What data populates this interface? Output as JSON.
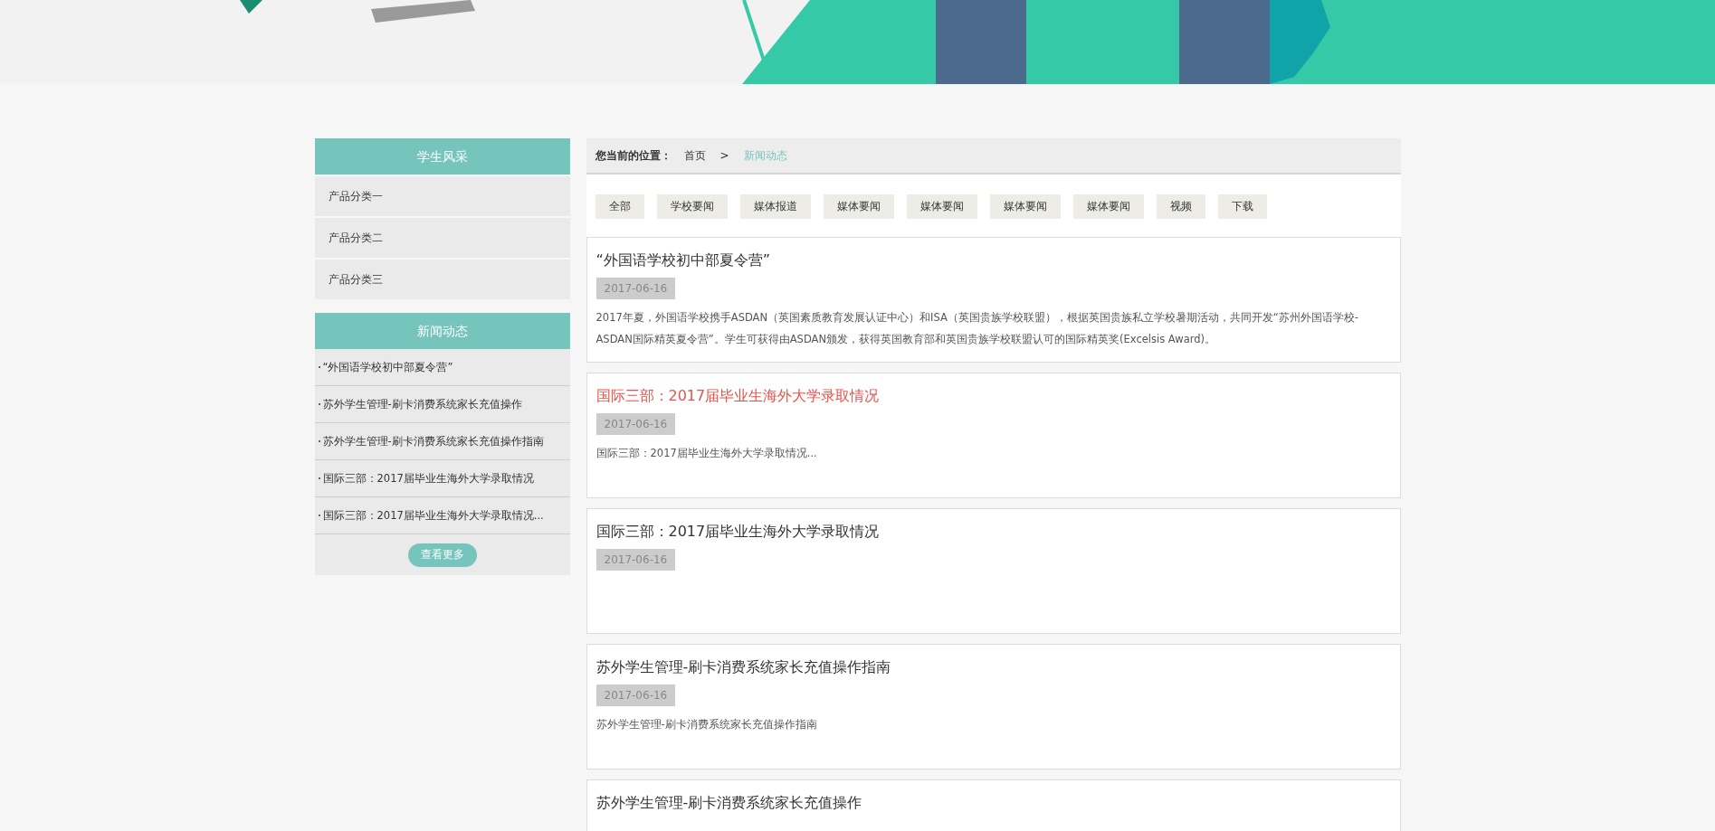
{
  "sidebar": {
    "categories": {
      "title": "学生风采",
      "items": [
        {
          "label": "产品分类一"
        },
        {
          "label": "产品分类二"
        },
        {
          "label": "产品分类三"
        }
      ]
    },
    "news": {
      "title": "新闻动态",
      "items": [
        {
          "label": "“外国语学校初中部夏令营”"
        },
        {
          "label": "苏外学生管理-刷卡消费系统家长充值操作"
        },
        {
          "label": "苏外学生管理-刷卡消费系统家长充值操作指南"
        },
        {
          "label": "国际三部：2017届毕业生海外大学录取情况"
        },
        {
          "label": "国际三部：2017届毕业生海外大学录取情况..."
        }
      ],
      "more_button": "查看更多"
    }
  },
  "breadcrumb": {
    "label": "您当前的位置：",
    "items": [
      {
        "text": "首页",
        "current": false
      },
      {
        "text": ">",
        "kind": "separator"
      },
      {
        "text": "新闻动态",
        "current": true
      }
    ]
  },
  "filter_tabs": [
    {
      "label": "全部"
    },
    {
      "label": "学校要闻"
    },
    {
      "label": "媒体报道"
    },
    {
      "label": "媒体要闻"
    },
    {
      "label": "媒体要闻"
    },
    {
      "label": "媒体要闻"
    },
    {
      "label": "媒体要闻"
    },
    {
      "label": "视频"
    },
    {
      "label": "下载"
    }
  ],
  "articles": [
    {
      "title": "“外国语学校初中部夏令营”",
      "highlighted": false,
      "date": "2017-06-16",
      "excerpt": "2017年夏，外国语学校携手ASDAN（英国素质教育发展认证中心）和ISA（英国贵族学校联盟），根据英国贵族私立学校暑期活动，共同开发“苏州外国语学校-ASDAN国际精英夏令营”。学生可获得由ASDAN颁发，获得英国教育部和英国贵族学校联盟认可的国际精英奖(Excelsis Award)。"
    },
    {
      "title": "国际三部：2017届毕业生海外大学录取情况",
      "highlighted": true,
      "date": "2017-06-16",
      "excerpt": "国际三部：2017届毕业生海外大学录取情况..."
    },
    {
      "title": "国际三部：2017届毕业生海外大学录取情况",
      "highlighted": false,
      "date": "2017-06-16"
    },
    {
      "title": "苏外学生管理-刷卡消费系统家长充值操作指南",
      "highlighted": false,
      "date": "2017-06-16",
      "excerpt": "苏外学生管理-刷卡消费系统家长充值操作指南"
    },
    {
      "title": "苏外学生管理-刷卡消费系统家长充值操作",
      "highlighted": false
    }
  ]
}
